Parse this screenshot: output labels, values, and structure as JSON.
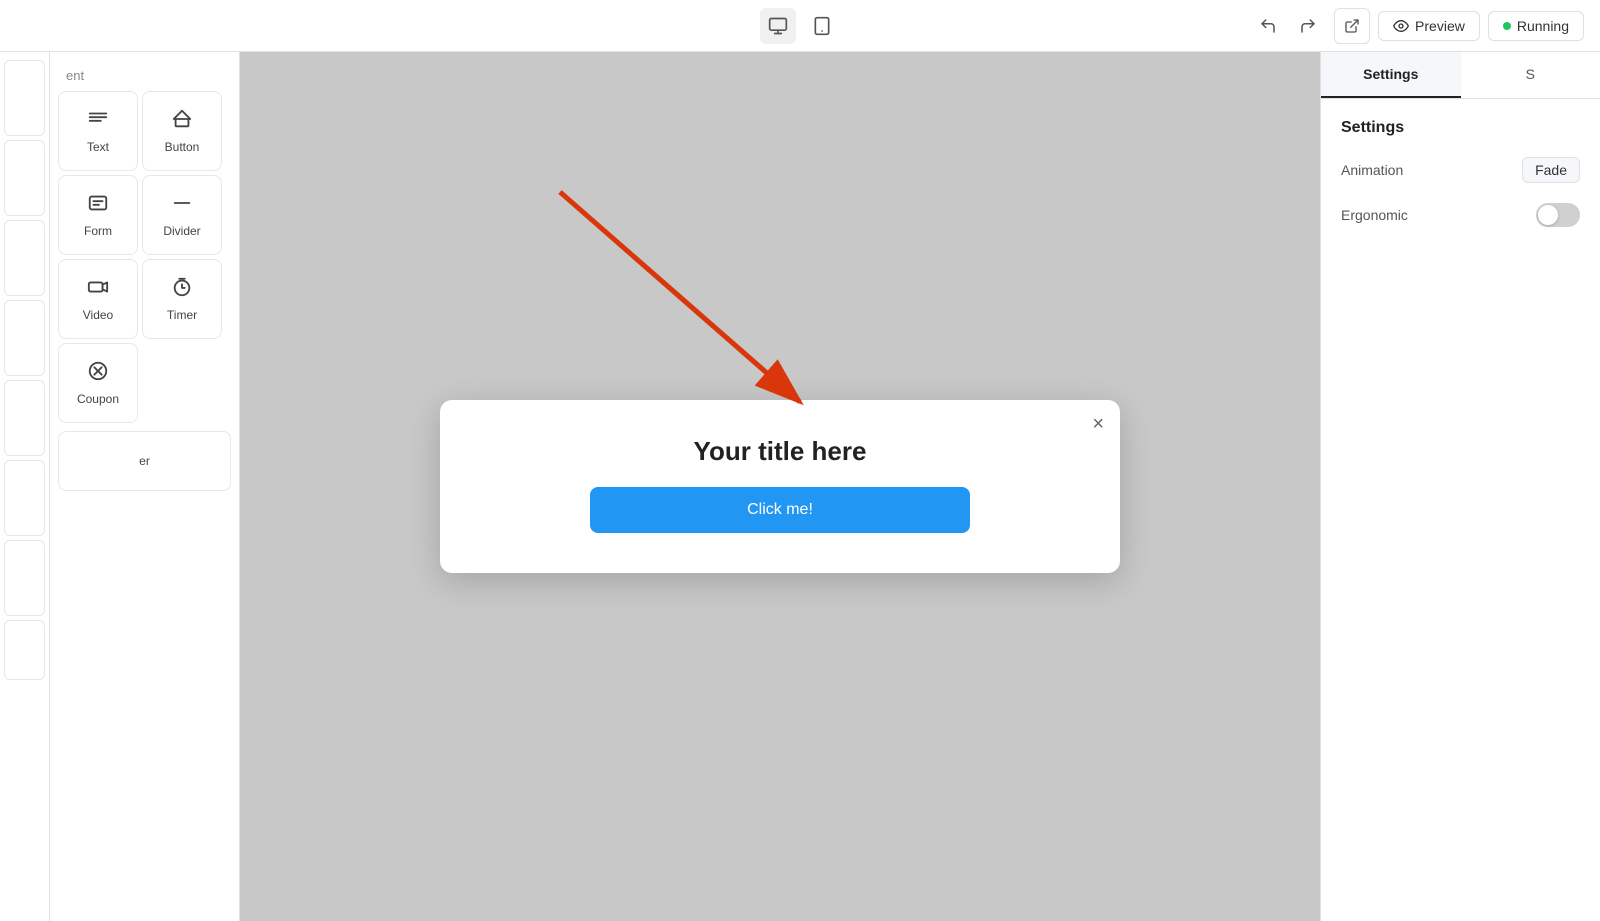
{
  "toolbar": {
    "undo_label": "↩",
    "redo_label": "↪",
    "preview_label": "Preview",
    "running_label": "Running",
    "desktop_icon": "desktop",
    "tablet_icon": "tablet",
    "external_icon": "external-link"
  },
  "left_sidebar": {
    "section_title": "ent",
    "items": [
      {
        "id": "text",
        "label": "Text",
        "icon": "≡"
      },
      {
        "id": "button",
        "label": "Button",
        "icon": "⬚"
      },
      {
        "id": "form",
        "label": "Form",
        "icon": "▬"
      },
      {
        "id": "divider",
        "label": "Divider",
        "icon": "—"
      },
      {
        "id": "video",
        "label": "Video",
        "icon": "▷"
      },
      {
        "id": "timer",
        "label": "Timer",
        "icon": "◷"
      },
      {
        "id": "coupon",
        "label": "Coupon",
        "icon": "⊘"
      }
    ]
  },
  "canvas": {
    "modal": {
      "title": "Your title here",
      "cta_label": "Click me!",
      "close_icon": "×"
    }
  },
  "right_sidebar": {
    "tabs": [
      {
        "id": "settings",
        "label": "Settings",
        "active": true
      },
      {
        "id": "style",
        "label": "S"
      }
    ],
    "settings_title": "Settings",
    "animation_label": "Animation",
    "animation_value": "Fade",
    "ergonomic_label": "Ergonomic",
    "ergonomic_on": false
  }
}
